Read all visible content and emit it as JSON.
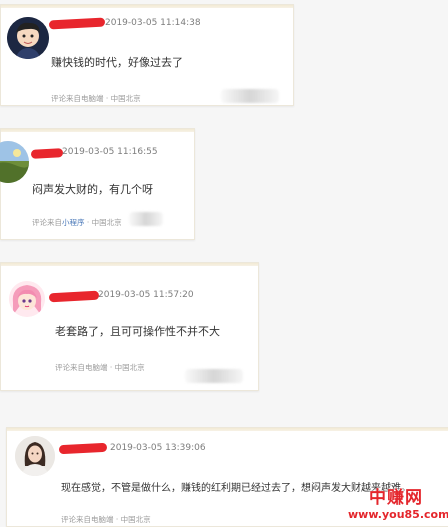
{
  "comments": [
    {
      "timestamp": "2019-03-05 11:14:38",
      "text": "赚快钱的时代，好像过去了",
      "source_prefix": "评论来自电脑端",
      "source_link": "",
      "location": "· 中国北京",
      "avatar_icon": "cartoon-boy-avatar-icon"
    },
    {
      "timestamp": "2019-03-05 11:16:55",
      "text": "闷声发大财的，有几个呀",
      "source_prefix": "评论来自",
      "source_link": "小程序",
      "location": "· 中国北京",
      "avatar_icon": "landscape-avatar-icon"
    },
    {
      "timestamp": "2019-03-05 11:57:20",
      "text": "老套路了，且可可操作性不并不大",
      "source_prefix": "评论来自电脑端",
      "source_link": "",
      "location": "· 中国北京",
      "avatar_icon": "anime-girl-avatar-icon"
    },
    {
      "timestamp": "2019-03-05 13:39:06",
      "text": "现在感觉，不管是做什么，赚钱的红利期已经过去了，想闷声发大财越来越难。",
      "source_prefix": "评论来自电脑端",
      "source_link": "",
      "location": "· 中国北京",
      "avatar_icon": "woman-photo-avatar-icon"
    }
  ],
  "watermark": {
    "name": "中赚网",
    "url": "www.you85.com"
  },
  "colors": {
    "redaction": "#e8262d",
    "watermark": "#e4262c",
    "link": "#4a78b8"
  }
}
